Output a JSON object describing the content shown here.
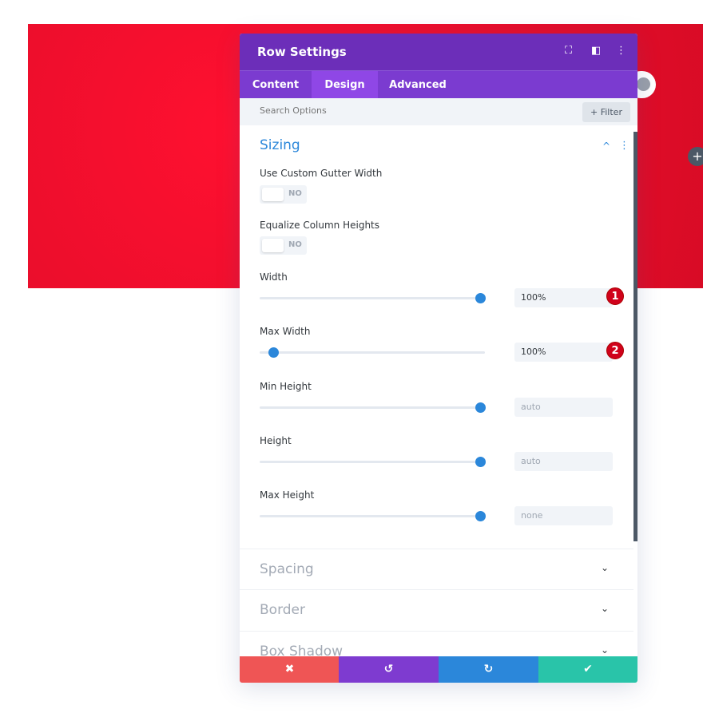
{
  "panel": {
    "title": "Row Settings",
    "icons": [
      "fullscreen-icon",
      "split-view-icon",
      "more-vert-icon"
    ]
  },
  "tabs": [
    {
      "label": "Content"
    },
    {
      "label": "Design",
      "active": true
    },
    {
      "label": "Advanced"
    }
  ],
  "search": {
    "placeholder": "Search Options",
    "filter_label": "+ Filter"
  },
  "sizing": {
    "title": "Sizing",
    "toggles": [
      {
        "label": "Use Custom Gutter Width",
        "value": "NO"
      },
      {
        "label": "Equalize Column Heights",
        "value": "NO"
      }
    ],
    "sliders": [
      {
        "label": "Width",
        "value": "100%",
        "level": 0.98,
        "badge": "1",
        "is_placeholder": false
      },
      {
        "label": "Max Width",
        "value": "100%",
        "level": 0.06,
        "badge": "2",
        "is_placeholder": false
      },
      {
        "label": "Min Height",
        "value": "auto",
        "level": 0.98,
        "is_placeholder": true
      },
      {
        "label": "Height",
        "value": "auto",
        "level": 0.98,
        "is_placeholder": true
      },
      {
        "label": "Max Height",
        "value": "none",
        "level": 0.98,
        "is_placeholder": true
      }
    ]
  },
  "sections": [
    {
      "title": "Spacing"
    },
    {
      "title": "Border"
    },
    {
      "title": "Box Shadow"
    }
  ],
  "footer": {
    "buttons": [
      {
        "name": "cancel",
        "icon": "✖",
        "color": "#ef5555"
      },
      {
        "name": "undo",
        "icon": "↺",
        "color": "#7e3bd0"
      },
      {
        "name": "redo",
        "icon": "↻",
        "color": "#2b87da"
      },
      {
        "name": "save",
        "icon": "✔",
        "color": "#29c4a9"
      }
    ]
  },
  "colors": {
    "header": "#6c2eb9",
    "tabs": "#7b3bd0",
    "accent": "#2b87da",
    "background": "#ff1030"
  }
}
